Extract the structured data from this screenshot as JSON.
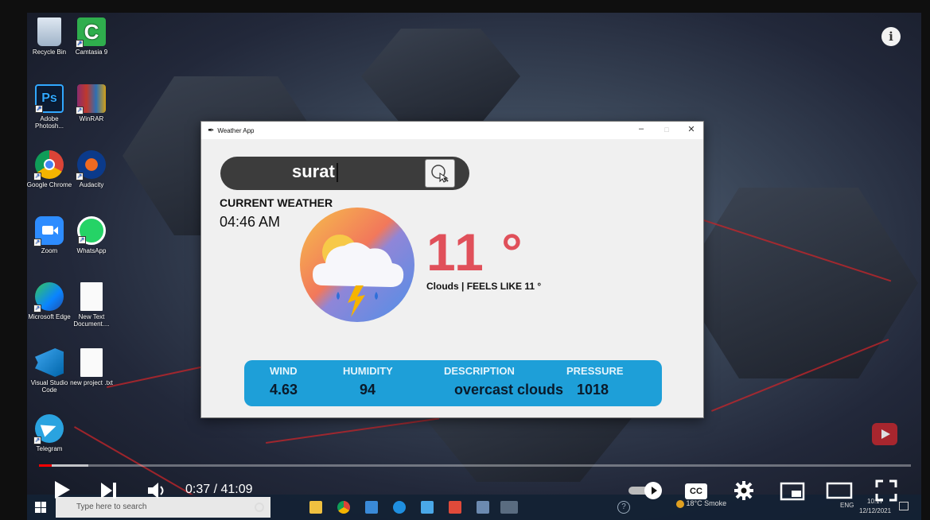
{
  "desktop": {
    "icons": [
      {
        "label": "Recycle Bin",
        "icon": "recycle-bin-icon"
      },
      {
        "label": "Camtasia 9",
        "icon": "camtasia-icon"
      },
      {
        "label": "Adobe Photosh...",
        "icon": "photoshop-icon"
      },
      {
        "label": "WinRAR",
        "icon": "winrar-icon"
      },
      {
        "label": "Google Chrome",
        "icon": "chrome-icon"
      },
      {
        "label": "Audacity",
        "icon": "audacity-icon"
      },
      {
        "label": "Zoom",
        "icon": "zoom-icon"
      },
      {
        "label": "WhatsApp",
        "icon": "whatsapp-icon"
      },
      {
        "label": "Microsoft Edge",
        "icon": "edge-icon"
      },
      {
        "label": "New Text Document....",
        "icon": "text-file-icon"
      },
      {
        "label": "Visual Studio Code",
        "icon": "vscode-icon"
      },
      {
        "label": "new project .txt",
        "icon": "text-file-icon"
      },
      {
        "label": "Telegram",
        "icon": "telegram-icon"
      }
    ]
  },
  "window": {
    "title": "Weather App",
    "minimize": "–",
    "maximize": "□",
    "close": "✕"
  },
  "app": {
    "search_value": "surat",
    "current_weather_label": "CURRENT WEATHER",
    "time": "04:46 AM",
    "temperature": "11 °",
    "condition_line": "Clouds | FEELS LIKE 11 °",
    "stats": {
      "wind_label": "WIND",
      "wind_value": "4.63",
      "humidity_label": "HUMIDITY",
      "humidity_value": "94",
      "description_label": "DESCRIPTION",
      "description_value": "overcast clouds",
      "pressure_label": "PRESSURE",
      "pressure_value": "1018"
    }
  },
  "player": {
    "time_display": "0:37 / 41:09",
    "progress_played": 0.015,
    "progress_loaded": 0.057,
    "accent": "#ff0000",
    "info_icon": "info-icon",
    "cc_label": "CC"
  },
  "taskbar": {
    "search_placeholder": "Type here to search",
    "weather": "18°C Smoke",
    "language": "ENG",
    "clock_time": "10:17",
    "clock_date": "12/12/2021"
  }
}
